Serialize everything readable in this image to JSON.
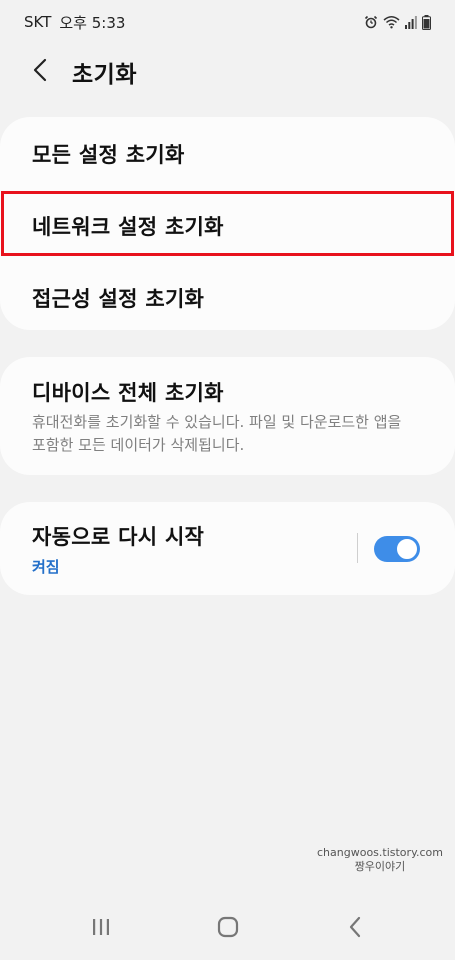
{
  "status_bar": {
    "carrier": "SKT",
    "time": "오후 5:33",
    "icons": [
      "alarm-icon",
      "wifi-icon",
      "signal-icon",
      "battery-icon"
    ]
  },
  "header": {
    "title": "초기화"
  },
  "reset_options": [
    {
      "label": "모든 설정 초기화"
    },
    {
      "label": "네트워크 설정 초기화"
    },
    {
      "label": "접근성 설정 초기화"
    }
  ],
  "device_reset": {
    "title": "디바이스 전체 초기화",
    "description": "휴대전화를 초기화할 수 있습니다. 파일 및 다운로드한 앱을 포함한 모든 데이터가 삭제됩니다."
  },
  "auto_restart": {
    "title": "자동으로 다시 시작",
    "status": "켜짐",
    "enabled": true
  },
  "watermark": {
    "line1": "changwoos.tistory.com",
    "line2": "짱우이야기"
  },
  "nav_bar": {
    "icons": [
      "recent-apps-icon",
      "home-icon",
      "back-icon"
    ]
  },
  "colors": {
    "accent": "#3e8de8",
    "status_text": "#2470c9",
    "highlight": "#e8121c",
    "background": "#f2f2f2",
    "card": "#fcfcfc"
  }
}
